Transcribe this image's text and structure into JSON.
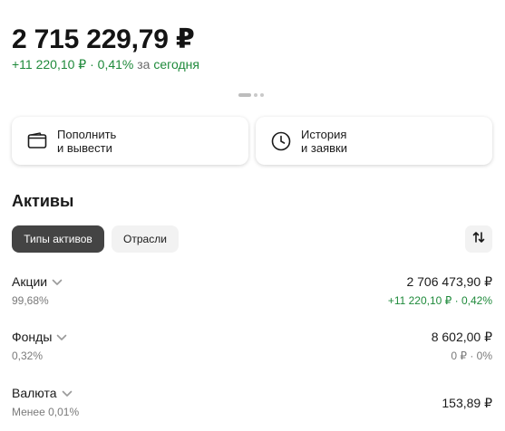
{
  "portfolio": {
    "total": "2 715 229,79 ₽",
    "change_amount": "+11 220,10 ₽",
    "change_sep": "·",
    "change_percent": "0,41%",
    "period_prefix": "за",
    "period_link": "сегодня"
  },
  "actions": [
    {
      "line1": "Пополнить",
      "line2": "и вывести",
      "icon": "wallet-icon"
    },
    {
      "line1": "История",
      "line2": "и заявки",
      "icon": "clock-icon"
    }
  ],
  "assets_section": {
    "title": "Активы",
    "filters": [
      "Типы активов",
      "Отрасли"
    ],
    "active_filter": "Типы активов",
    "sort_icon": "sort-arrows-icon"
  },
  "assets": [
    {
      "name": "Акции",
      "share": "99,68%",
      "value": "2 706 473,90 ₽",
      "delta": "+11 220,10 ₽ · 0,42%",
      "delta_positive": true
    },
    {
      "name": "Фонды",
      "share": "0,32%",
      "value": "8 602,00 ₽",
      "delta": "0 ₽ · 0%",
      "delta_positive": false
    },
    {
      "name": "Валюта",
      "share": "Менее 0,01%",
      "value": "153,89 ₽",
      "delta": "",
      "delta_positive": false
    }
  ],
  "colors": {
    "positive": "#1f8a3b",
    "chip_active": "#444444",
    "chip_inactive": "#f2f2f2"
  }
}
